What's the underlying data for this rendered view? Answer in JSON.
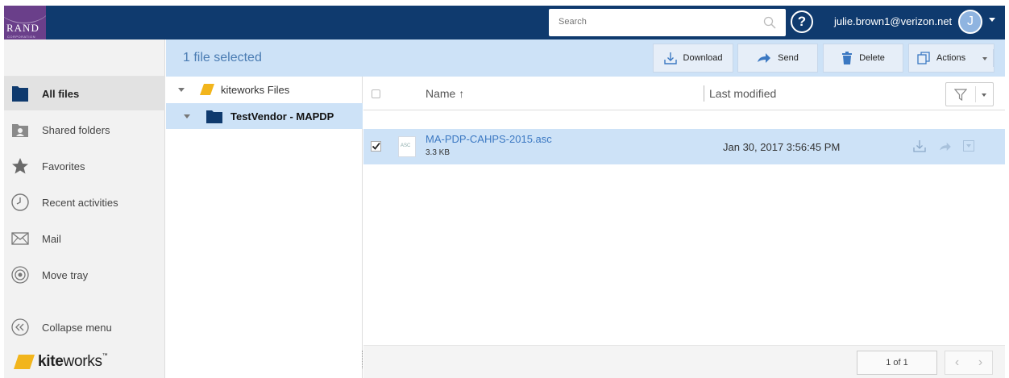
{
  "header": {
    "logo_text": "RAND",
    "logo_subtext": "CORPORATION",
    "search_placeholder": "Search",
    "help_label": "?",
    "user_email": "julie.brown1@verizon.net",
    "avatar_initial": "J"
  },
  "sidebar": {
    "items": [
      {
        "label": "All files",
        "icon": "folder-icon",
        "active": true
      },
      {
        "label": "Shared folders",
        "icon": "shared-folder-icon"
      },
      {
        "label": "Favorites",
        "icon": "star-icon"
      },
      {
        "label": "Recent activities",
        "icon": "clock-icon"
      },
      {
        "label": "Mail",
        "icon": "mail-icon"
      },
      {
        "label": "Move tray",
        "icon": "target-icon"
      }
    ],
    "collapse_label": "Collapse menu",
    "brand_bold": "kite",
    "brand_rest": "works",
    "brand_tm": "™"
  },
  "toolbar": {
    "selection_text": "1 file selected",
    "download_label": "Download",
    "send_label": "Send",
    "delete_label": "Delete",
    "actions_label": "Actions"
  },
  "tree": {
    "root_label": "kiteworks Files",
    "child_label": "TestVendor - MAPDP"
  },
  "list": {
    "col_name": "Name",
    "sort_arrow": "↑",
    "col_modified": "Last modified",
    "files": [
      {
        "name": "MA-PDP-CAHPS-2015.asc",
        "size": "3.3 KB",
        "modified": "Jan 30, 2017 3:56:45 PM",
        "type_label": "ASC",
        "checked": true
      }
    ],
    "pagination": "1 of 1",
    "prev": "‹",
    "next": "›"
  },
  "colors": {
    "header_bg": "#0f3a6e",
    "selection_bg": "#cde2f7",
    "logo_bg": "#6a3f8a",
    "brand_yellow": "#f2b51c",
    "link_blue": "#3b78c2"
  }
}
